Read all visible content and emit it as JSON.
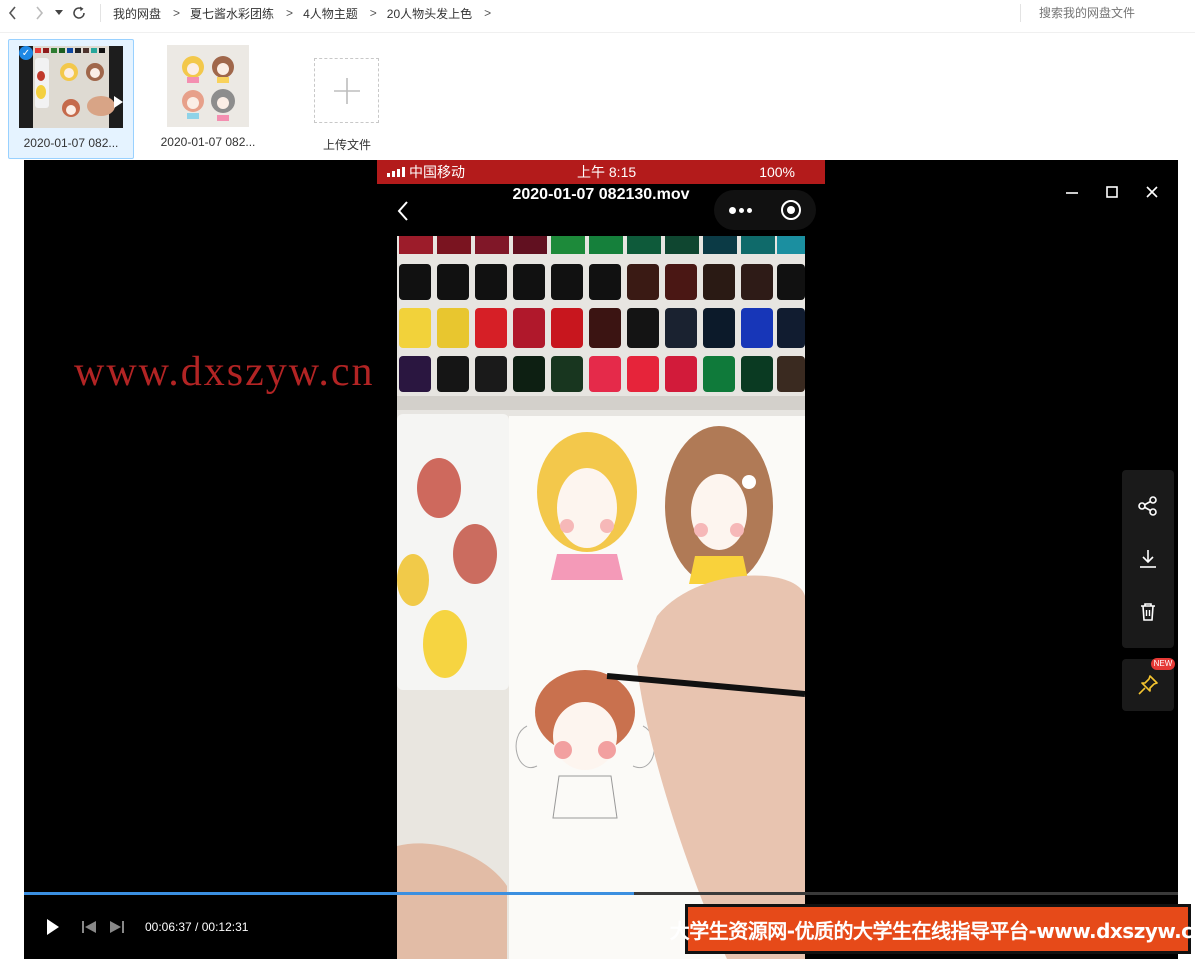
{
  "breadcrumbs": [
    "我的网盘",
    "夏七酱水彩团练",
    "4人物主题",
    "20人物头发上色"
  ],
  "breadcrumb_separator": ">",
  "search": {
    "placeholder": "搜索我的网盘文件"
  },
  "files": [
    {
      "name": "2020-01-07 082...",
      "type": "video",
      "selected": true
    },
    {
      "name": "2020-01-07 082...",
      "type": "image",
      "selected": false
    }
  ],
  "upload": {
    "label": "上传文件",
    "icon": "plus-icon"
  },
  "player": {
    "title": "2020-01-07 082130.mov",
    "phone_status": {
      "carrier": "中国移动",
      "time": "上午 8:15",
      "battery": "100%"
    },
    "current_time": "00:06:37",
    "total_time": "00:12:31",
    "time_separator": " / ",
    "progress": 0.529,
    "new_badge": "NEW"
  },
  "watermark": "www.dxszyw.cn",
  "banner": "大学生资源网-优质的大学生在线指导平台-www.dxszyw.cn",
  "colors": {
    "accent": "#3b8fe0",
    "selected_bg": "#e5f3ff",
    "status_red": "#b31b1b",
    "banner": "#e64a19",
    "watermark": "#c62828"
  }
}
